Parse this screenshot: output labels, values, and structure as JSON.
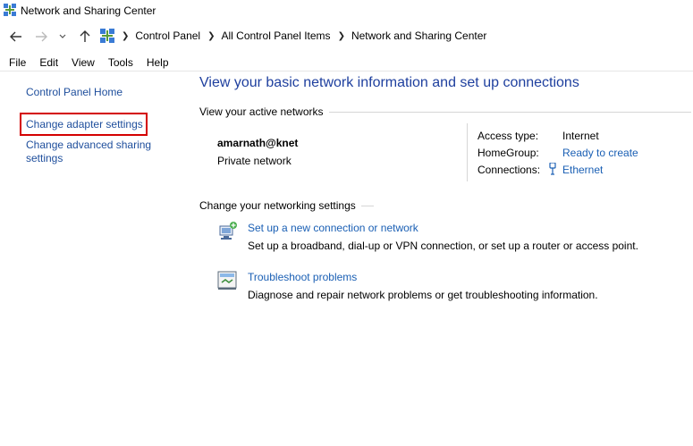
{
  "window": {
    "title": "Network and Sharing Center"
  },
  "address": {
    "crumbs": [
      "Control Panel",
      "All Control Panel Items",
      "Network and Sharing Center"
    ]
  },
  "menu": [
    "File",
    "Edit",
    "View",
    "Tools",
    "Help"
  ],
  "sidebar": {
    "home": "Control Panel Home",
    "adapter": "Change adapter settings",
    "sharing_line1": "Change advanced sharing",
    "sharing_line2": "settings"
  },
  "main": {
    "title": "View your basic network information and set up connections",
    "active_networks_heading": "View your active networks",
    "network": {
      "name": "amarnath@knet",
      "type": "Private network",
      "access_type_label": "Access type:",
      "access_type_value": "Internet",
      "homegroup_label": "HomeGroup:",
      "homegroup_value": "Ready to create",
      "connections_label": "Connections:",
      "connections_value": "Ethernet"
    },
    "settings_heading": "Change your networking settings",
    "tasks": [
      {
        "link": "Set up a new connection or network",
        "desc": "Set up a broadband, dial-up or VPN connection, or set up a router or access point.",
        "icon": "new-connection-icon"
      },
      {
        "link": "Troubleshoot problems",
        "desc": "Diagnose and repair network problems or get troubleshooting information.",
        "icon": "troubleshoot-icon"
      }
    ]
  },
  "colors": {
    "link": "#1a5fb4",
    "title": "#1e3f9e",
    "highlight": "#d40000"
  }
}
